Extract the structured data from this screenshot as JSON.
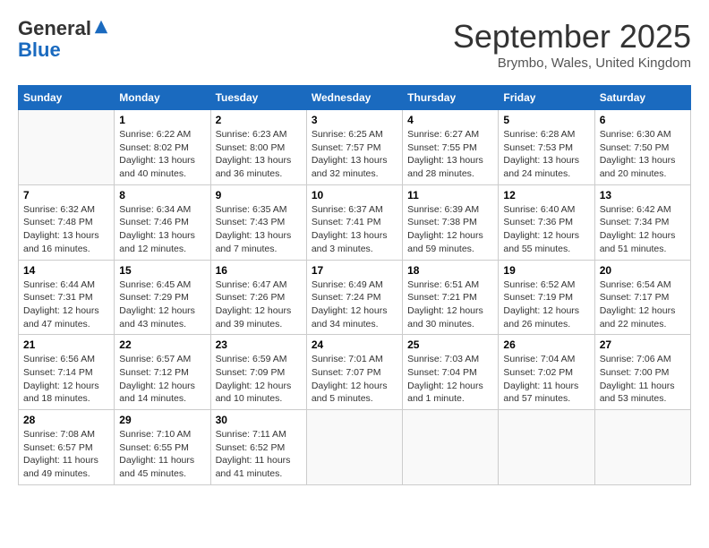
{
  "header": {
    "logo_line1": "General",
    "logo_line2": "Blue",
    "month_title": "September 2025",
    "subtitle": "Brymbo, Wales, United Kingdom"
  },
  "days_of_week": [
    "Sunday",
    "Monday",
    "Tuesday",
    "Wednesday",
    "Thursday",
    "Friday",
    "Saturday"
  ],
  "weeks": [
    [
      {
        "day": "",
        "info": ""
      },
      {
        "day": "1",
        "info": "Sunrise: 6:22 AM\nSunset: 8:02 PM\nDaylight: 13 hours\nand 40 minutes."
      },
      {
        "day": "2",
        "info": "Sunrise: 6:23 AM\nSunset: 8:00 PM\nDaylight: 13 hours\nand 36 minutes."
      },
      {
        "day": "3",
        "info": "Sunrise: 6:25 AM\nSunset: 7:57 PM\nDaylight: 13 hours\nand 32 minutes."
      },
      {
        "day": "4",
        "info": "Sunrise: 6:27 AM\nSunset: 7:55 PM\nDaylight: 13 hours\nand 28 minutes."
      },
      {
        "day": "5",
        "info": "Sunrise: 6:28 AM\nSunset: 7:53 PM\nDaylight: 13 hours\nand 24 minutes."
      },
      {
        "day": "6",
        "info": "Sunrise: 6:30 AM\nSunset: 7:50 PM\nDaylight: 13 hours\nand 20 minutes."
      }
    ],
    [
      {
        "day": "7",
        "info": "Sunrise: 6:32 AM\nSunset: 7:48 PM\nDaylight: 13 hours\nand 16 minutes."
      },
      {
        "day": "8",
        "info": "Sunrise: 6:34 AM\nSunset: 7:46 PM\nDaylight: 13 hours\nand 12 minutes."
      },
      {
        "day": "9",
        "info": "Sunrise: 6:35 AM\nSunset: 7:43 PM\nDaylight: 13 hours\nand 7 minutes."
      },
      {
        "day": "10",
        "info": "Sunrise: 6:37 AM\nSunset: 7:41 PM\nDaylight: 13 hours\nand 3 minutes."
      },
      {
        "day": "11",
        "info": "Sunrise: 6:39 AM\nSunset: 7:38 PM\nDaylight: 12 hours\nand 59 minutes."
      },
      {
        "day": "12",
        "info": "Sunrise: 6:40 AM\nSunset: 7:36 PM\nDaylight: 12 hours\nand 55 minutes."
      },
      {
        "day": "13",
        "info": "Sunrise: 6:42 AM\nSunset: 7:34 PM\nDaylight: 12 hours\nand 51 minutes."
      }
    ],
    [
      {
        "day": "14",
        "info": "Sunrise: 6:44 AM\nSunset: 7:31 PM\nDaylight: 12 hours\nand 47 minutes."
      },
      {
        "day": "15",
        "info": "Sunrise: 6:45 AM\nSunset: 7:29 PM\nDaylight: 12 hours\nand 43 minutes."
      },
      {
        "day": "16",
        "info": "Sunrise: 6:47 AM\nSunset: 7:26 PM\nDaylight: 12 hours\nand 39 minutes."
      },
      {
        "day": "17",
        "info": "Sunrise: 6:49 AM\nSunset: 7:24 PM\nDaylight: 12 hours\nand 34 minutes."
      },
      {
        "day": "18",
        "info": "Sunrise: 6:51 AM\nSunset: 7:21 PM\nDaylight: 12 hours\nand 30 minutes."
      },
      {
        "day": "19",
        "info": "Sunrise: 6:52 AM\nSunset: 7:19 PM\nDaylight: 12 hours\nand 26 minutes."
      },
      {
        "day": "20",
        "info": "Sunrise: 6:54 AM\nSunset: 7:17 PM\nDaylight: 12 hours\nand 22 minutes."
      }
    ],
    [
      {
        "day": "21",
        "info": "Sunrise: 6:56 AM\nSunset: 7:14 PM\nDaylight: 12 hours\nand 18 minutes."
      },
      {
        "day": "22",
        "info": "Sunrise: 6:57 AM\nSunset: 7:12 PM\nDaylight: 12 hours\nand 14 minutes."
      },
      {
        "day": "23",
        "info": "Sunrise: 6:59 AM\nSunset: 7:09 PM\nDaylight: 12 hours\nand 10 minutes."
      },
      {
        "day": "24",
        "info": "Sunrise: 7:01 AM\nSunset: 7:07 PM\nDaylight: 12 hours\nand 5 minutes."
      },
      {
        "day": "25",
        "info": "Sunrise: 7:03 AM\nSunset: 7:04 PM\nDaylight: 12 hours\nand 1 minute."
      },
      {
        "day": "26",
        "info": "Sunrise: 7:04 AM\nSunset: 7:02 PM\nDaylight: 11 hours\nand 57 minutes."
      },
      {
        "day": "27",
        "info": "Sunrise: 7:06 AM\nSunset: 7:00 PM\nDaylight: 11 hours\nand 53 minutes."
      }
    ],
    [
      {
        "day": "28",
        "info": "Sunrise: 7:08 AM\nSunset: 6:57 PM\nDaylight: 11 hours\nand 49 minutes."
      },
      {
        "day": "29",
        "info": "Sunrise: 7:10 AM\nSunset: 6:55 PM\nDaylight: 11 hours\nand 45 minutes."
      },
      {
        "day": "30",
        "info": "Sunrise: 7:11 AM\nSunset: 6:52 PM\nDaylight: 11 hours\nand 41 minutes."
      },
      {
        "day": "",
        "info": ""
      },
      {
        "day": "",
        "info": ""
      },
      {
        "day": "",
        "info": ""
      },
      {
        "day": "",
        "info": ""
      }
    ]
  ]
}
